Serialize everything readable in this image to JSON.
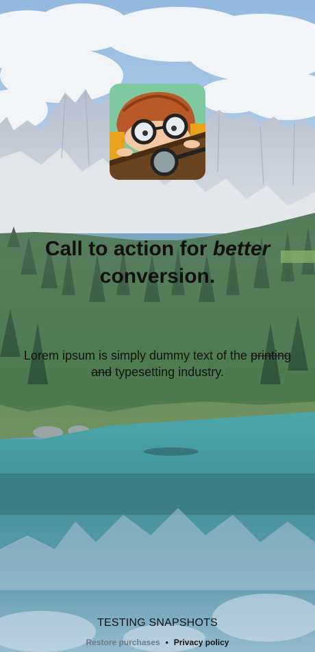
{
  "headline": {
    "part1": "Call to action for ",
    "emphasis": "better",
    "part2": " conversion."
  },
  "subtitle": {
    "part1": "Lorem ipsum is simply dummy text of the ",
    "struck": "printing and",
    "part2": " typesetting industry."
  },
  "footer": {
    "title": "TESTING SNAPSHOTS",
    "restore_label": "Restore purchases",
    "separator": "•",
    "privacy_label": "Privacy policy"
  },
  "app_icon": {
    "icon": "cartoon-kid-magnifier-icon",
    "background_color": "#7fc9a0"
  },
  "background": {
    "description_icon": "mountain-lake-landscape"
  }
}
